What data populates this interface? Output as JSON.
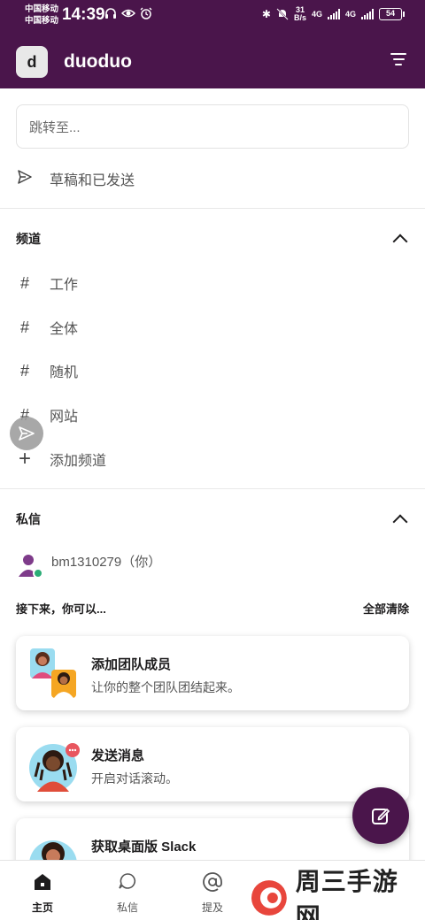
{
  "status_bar": {
    "carrier_1": "中国移动",
    "carrier_2": "中国移动",
    "time": "14:39",
    "net_speed_value": "31",
    "net_speed_unit": "B/s",
    "net_1": "4G",
    "net_2": "4G",
    "battery": "54"
  },
  "header": {
    "workspace_initial": "d",
    "workspace_name": "duoduo"
  },
  "search": {
    "placeholder": "跳转至..."
  },
  "drafts": {
    "label": "草稿和已发送"
  },
  "channels": {
    "title": "频道",
    "items": [
      {
        "label": "工作"
      },
      {
        "label": "全体"
      },
      {
        "label": "随机"
      },
      {
        "label": "网站"
      }
    ],
    "add_label": "添加频道"
  },
  "dms": {
    "title": "私信",
    "items": [
      {
        "label": "bm1310279（你）"
      }
    ]
  },
  "next": {
    "title": "接下来，你可以...",
    "clear_all": "全部清除",
    "cards": [
      {
        "title": "添加团队成员",
        "subtitle": "让你的整个团队团结起来。"
      },
      {
        "title": "发送消息",
        "subtitle": "开启对话滚动。"
      },
      {
        "title": "获取桌面版 Slack",
        "subtitle": ""
      }
    ]
  },
  "tabs": [
    {
      "label": "主页"
    },
    {
      "label": "私信"
    },
    {
      "label": "提及"
    }
  ],
  "watermark": {
    "text": "周三手游网"
  },
  "colors": {
    "brand": "#4a154b",
    "online": "#2bac76"
  }
}
